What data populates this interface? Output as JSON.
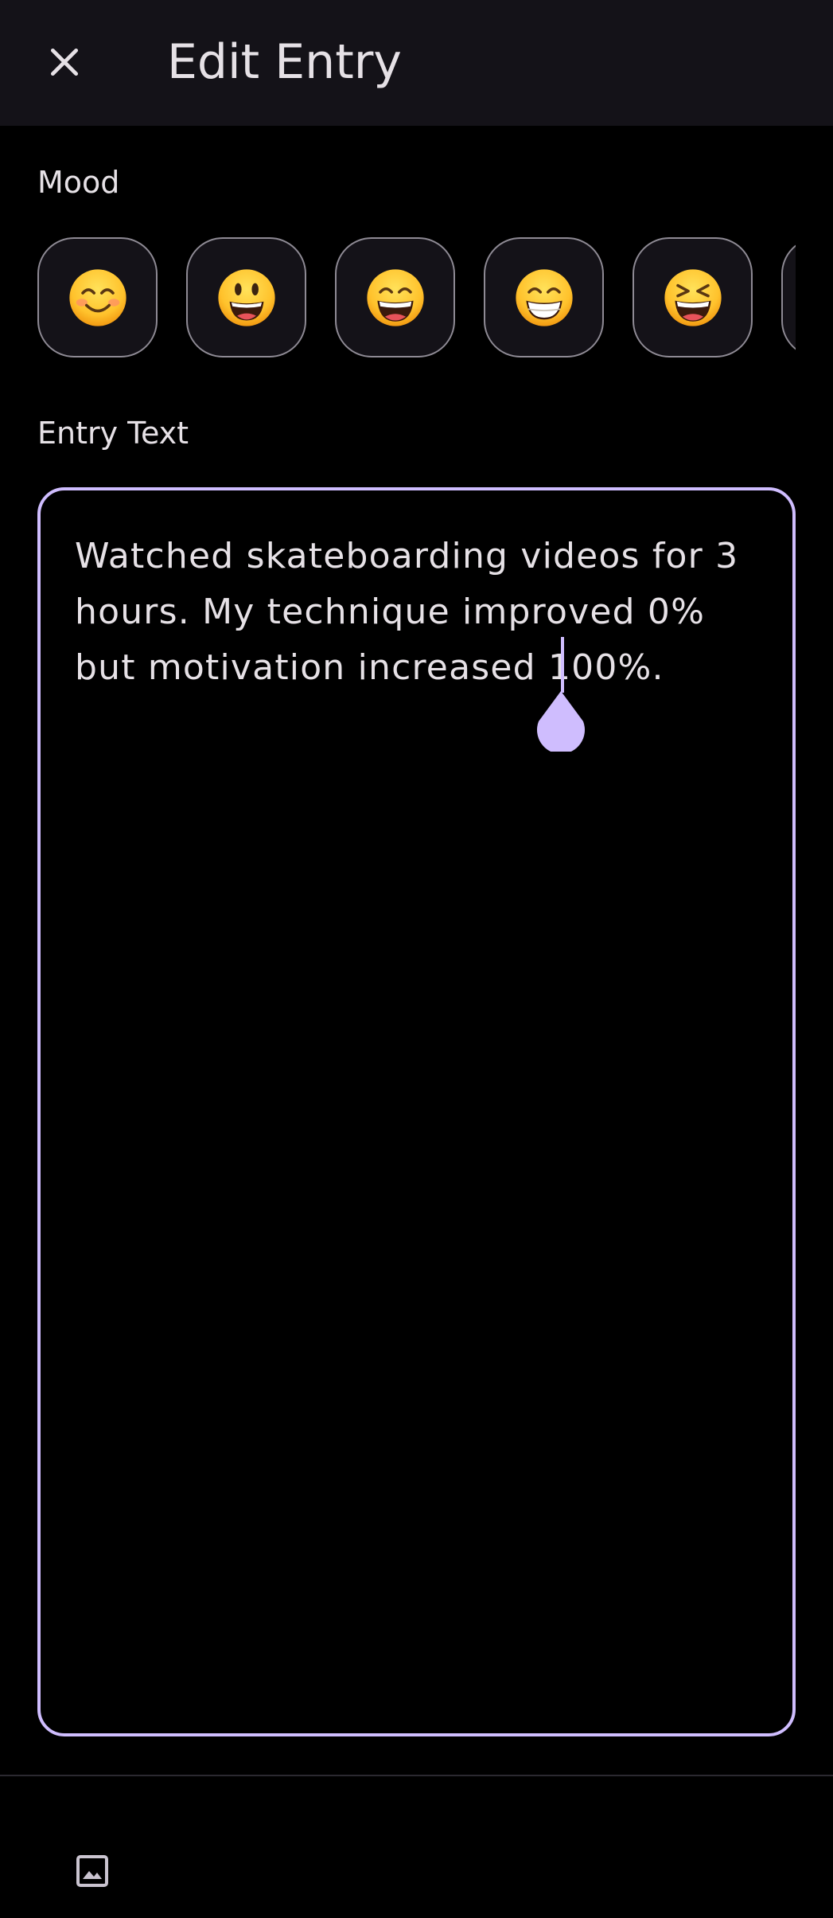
{
  "header": {
    "title": "Edit Entry",
    "close_icon": "close-icon"
  },
  "mood": {
    "label": "Mood",
    "options": [
      {
        "icon": "smiling-face-with-smiling-eyes-emoji"
      },
      {
        "icon": "grinning-face-with-big-eyes-emoji"
      },
      {
        "icon": "grinning-face-with-smiling-eyes-emoji"
      },
      {
        "icon": "beaming-face-with-smiling-eyes-emoji"
      },
      {
        "icon": "grinning-squinting-face-emoji"
      }
    ]
  },
  "entry": {
    "label": "Entry Text",
    "value": "Watched skateboarding videos for 3 hours. My technique improved 0% but motivation increased 100%."
  },
  "toolbar": {
    "image_icon": "image-icon"
  },
  "colors": {
    "accent": "#cfbdfe",
    "background": "#000000",
    "surface": "#141218",
    "text": "#e6e1e6",
    "outline": "#8e8a94"
  }
}
